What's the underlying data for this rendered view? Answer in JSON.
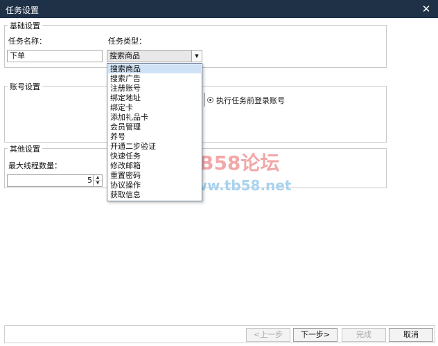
{
  "window": {
    "title": "任务设置"
  },
  "basic": {
    "legend": "基础设置",
    "task_name_label": "任务名称：",
    "task_name_value": "下单",
    "task_type_label": "任务类型：",
    "task_type_value": "搜索商品"
  },
  "dropdown": {
    "options": [
      "搜索商品",
      "搜索广告",
      "注册账号",
      "绑定地址",
      "绑定卡",
      "添加礼品卡",
      "会员管理",
      "养号",
      "开通二步验证",
      "快速任务",
      "修改邮箱",
      "重置密码",
      "协议操作",
      "获取信息"
    ],
    "selected": "搜索商品"
  },
  "account": {
    "legend": "账号设置",
    "login_option_label": "执行任务前登录账号"
  },
  "other": {
    "legend": "其他设置",
    "max_threads_label": "最大线程数量：",
    "max_threads_value": "5"
  },
  "buttons": {
    "prev": "<上一步",
    "next": "下一步>",
    "finish": "完成",
    "cancel": "取消"
  },
  "watermark": {
    "title": "TB58论坛",
    "url": "www.tb58.net"
  },
  "colors": {
    "titlebar": "#1f3147",
    "selection": "#d0e2f6",
    "watermark_red": "#f2a7a7",
    "watermark_blue": "#a9d3ee"
  }
}
